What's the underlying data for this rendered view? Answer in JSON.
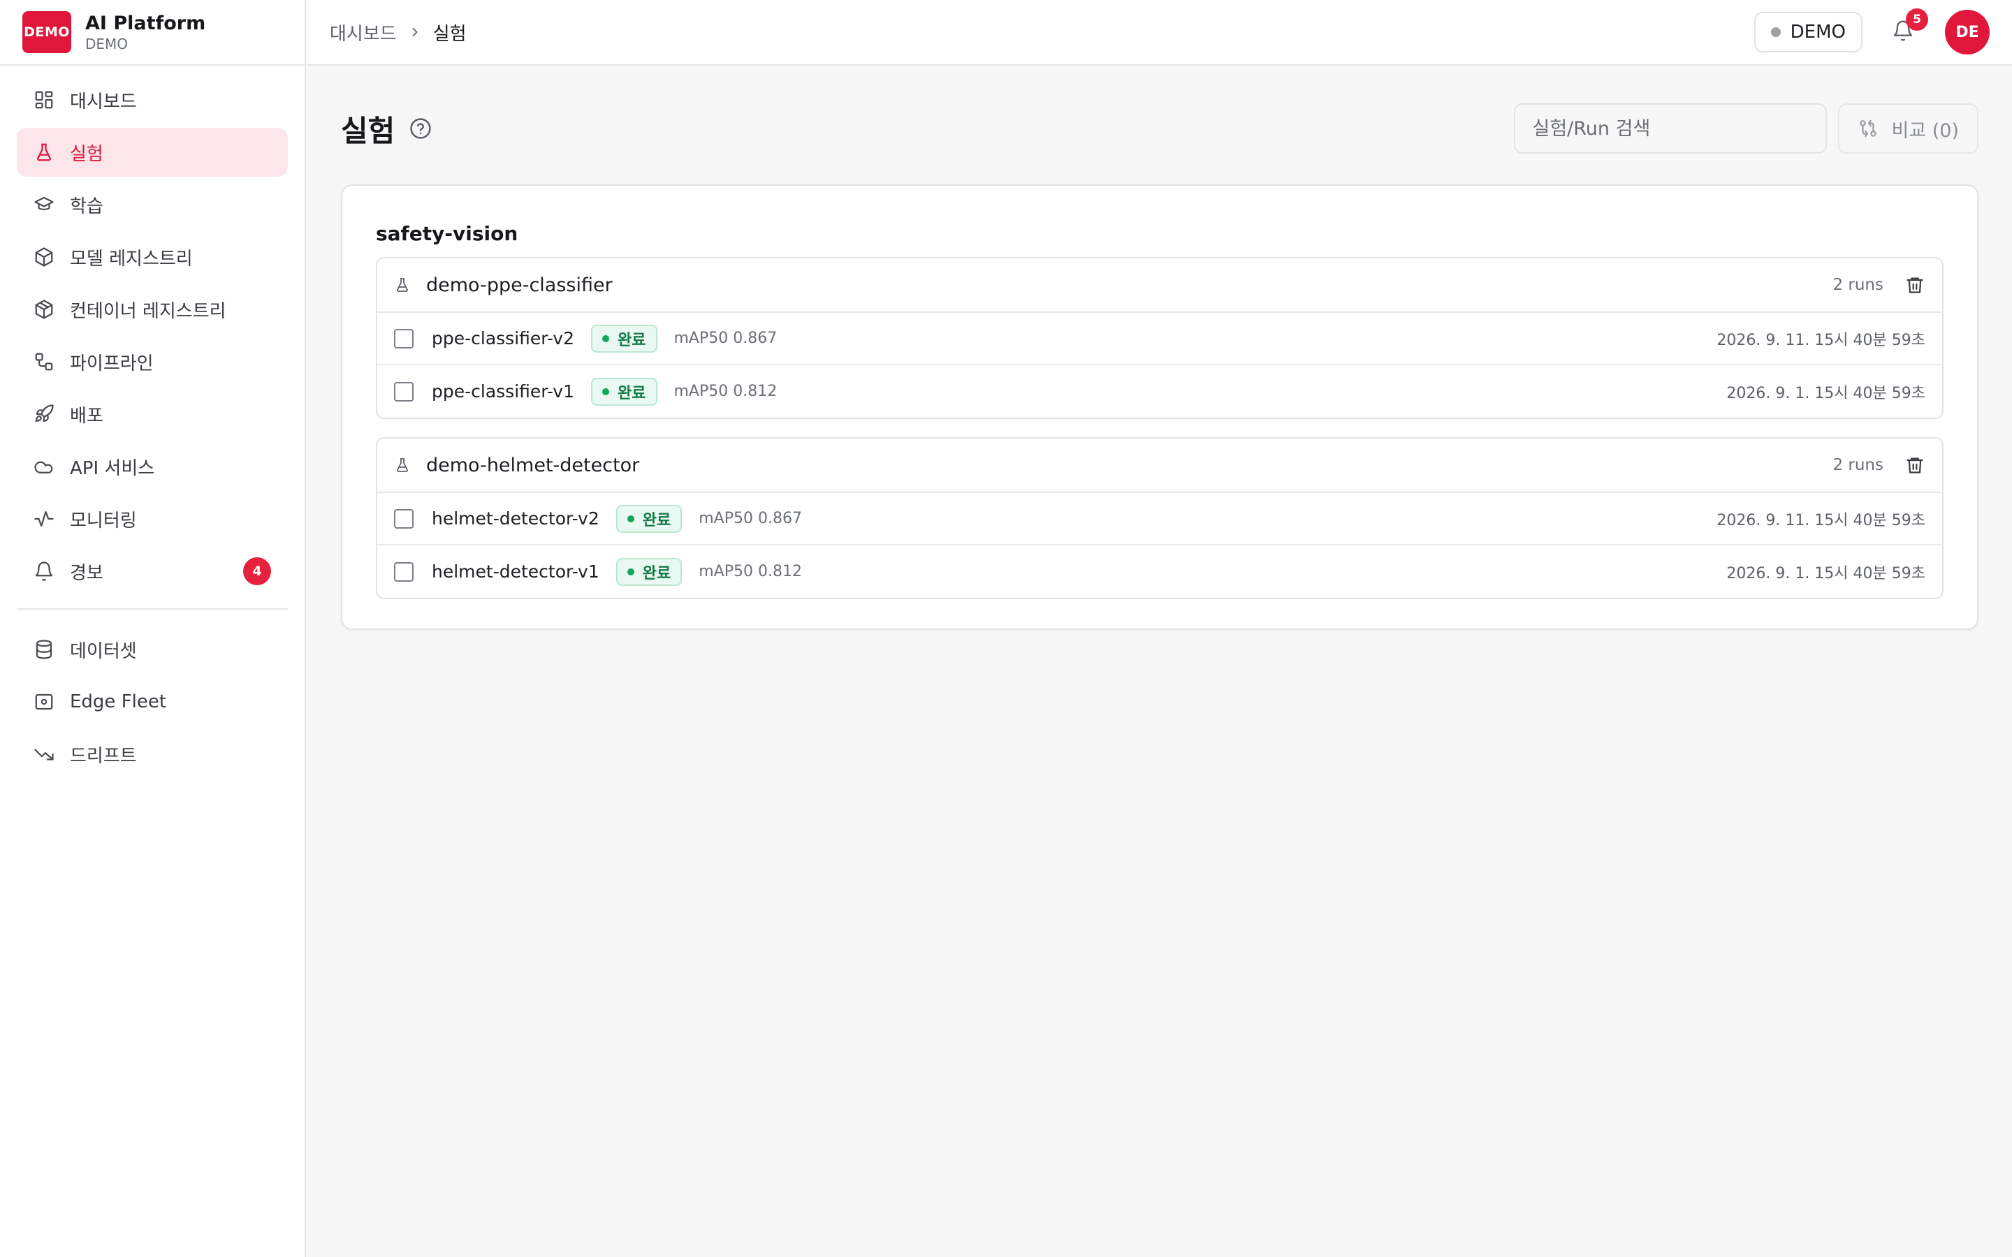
{
  "brand": {
    "logo_text": "DEMO",
    "title": "AI Platform",
    "subtitle": "DEMO",
    "accent_color": "#e0173b"
  },
  "sidebar": {
    "items": [
      {
        "label": "대시보드",
        "icon": "grid-icon",
        "active": false
      },
      {
        "label": "실험",
        "icon": "flask-icon",
        "active": true
      },
      {
        "label": "학습",
        "icon": "graduation-cap-icon",
        "active": false
      },
      {
        "label": "모델 레지스트리",
        "icon": "cube-icon",
        "active": false
      },
      {
        "label": "컨테이너 레지스트리",
        "icon": "container-icon",
        "active": false
      },
      {
        "label": "파이프라인",
        "icon": "workflow-icon",
        "active": false
      },
      {
        "label": "배포",
        "icon": "rocket-icon",
        "active": false
      },
      {
        "label": "API 서비스",
        "icon": "cloud-icon",
        "active": false
      },
      {
        "label": "모니터링",
        "icon": "activity-icon",
        "active": false
      },
      {
        "label": "경보",
        "icon": "bell-icon",
        "active": false,
        "badge": "4"
      }
    ],
    "secondary_items": [
      {
        "label": "데이터셋",
        "icon": "database-icon"
      },
      {
        "label": "Edge Fleet",
        "icon": "router-icon"
      },
      {
        "label": "드리프트",
        "icon": "trending-down-icon"
      }
    ]
  },
  "topbar": {
    "breadcrumb": {
      "parent": "대시보드",
      "current": "실험"
    },
    "env_label": "DEMO",
    "notification_count": "5",
    "avatar_initials": "DE"
  },
  "page": {
    "title": "실험",
    "search_placeholder": "실험/Run 검색",
    "compare_label": "비교 (0)"
  },
  "project": {
    "name": "safety-vision",
    "experiments": [
      {
        "name": "demo-ppe-classifier",
        "runs_label": "2 runs",
        "runs": [
          {
            "name": "ppe-classifier-v2",
            "status": "완료",
            "metric": "mAP50 0.867",
            "time": "2026. 9. 11. 15시 40분 59초"
          },
          {
            "name": "ppe-classifier-v1",
            "status": "완료",
            "metric": "mAP50 0.812",
            "time": "2026. 9. 1. 15시 40분 59초"
          }
        ]
      },
      {
        "name": "demo-helmet-detector",
        "runs_label": "2 runs",
        "runs": [
          {
            "name": "helmet-detector-v2",
            "status": "완료",
            "metric": "mAP50 0.867",
            "time": "2026. 9. 11. 15시 40분 59초"
          },
          {
            "name": "helmet-detector-v1",
            "status": "완료",
            "metric": "mAP50 0.812",
            "time": "2026. 9. 1. 15시 40분 59초"
          }
        ]
      }
    ]
  },
  "colors": {
    "accent": "#e0173b",
    "success": "#12a55c",
    "badge_red": "#e5213d"
  }
}
